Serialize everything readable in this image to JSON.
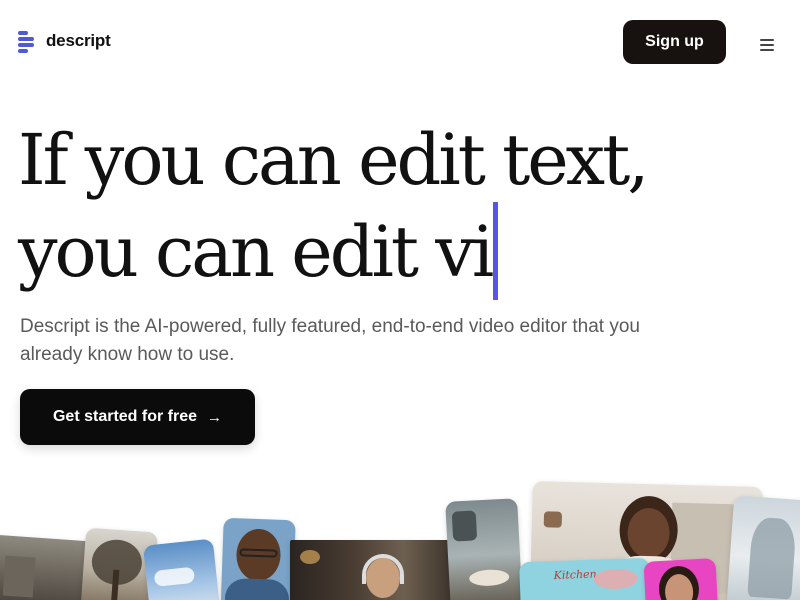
{
  "header": {
    "logo_text": "descript",
    "signup_label": "Sign up",
    "menu_icon": "hamburger-menu-icon"
  },
  "hero": {
    "headline_line1": "If you can edit text,",
    "headline_line2": "you can edit vi",
    "subtitle": "Descript is the AI-powered, fully featured, end-to-end video editor that you already know how to use.",
    "cta_label": "Get started for free",
    "cta_icon": "arrow-right-icon"
  },
  "collage": {
    "sticker_text": "Kitchen"
  },
  "colors": {
    "accent": "#5a53e8",
    "logo": "#4f5bd5",
    "button_dark": "#17120f"
  }
}
